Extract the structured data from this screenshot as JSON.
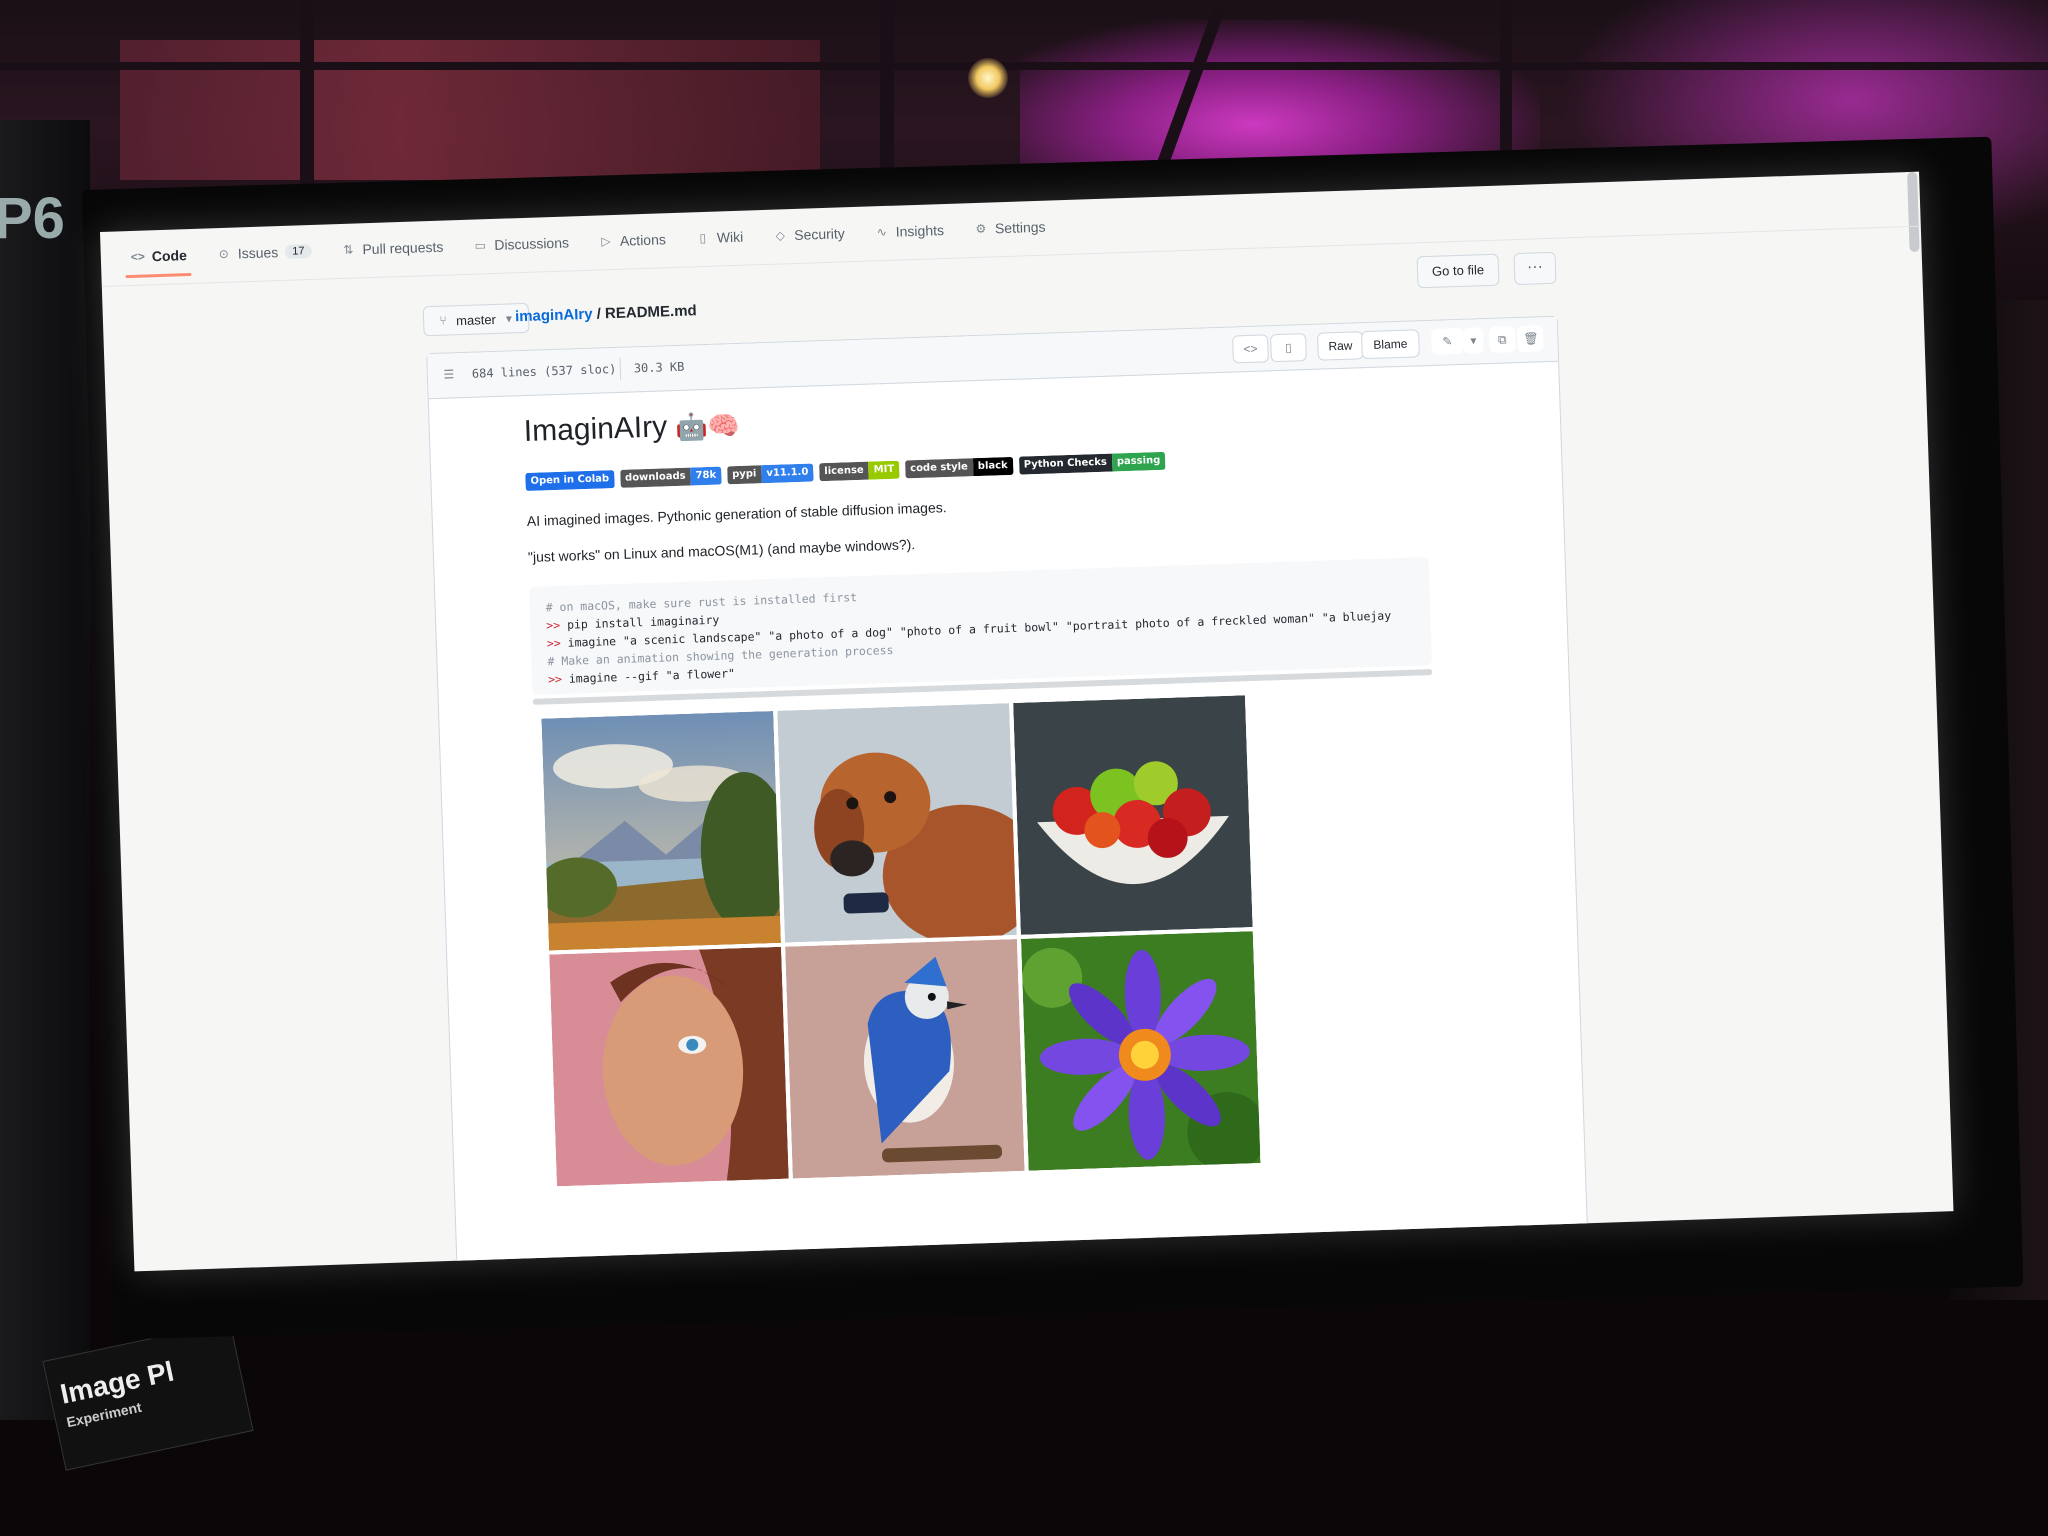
{
  "repo_nav": {
    "code": "Code",
    "issues": "Issues",
    "issues_count": "17",
    "pull_requests": "Pull requests",
    "discussions": "Discussions",
    "actions": "Actions",
    "wiki": "Wiki",
    "security": "Security",
    "insights": "Insights",
    "settings": "Settings"
  },
  "breadcrumb": {
    "branch": "master",
    "repo": "imaginAIry",
    "separator": "/",
    "file": "README.md"
  },
  "header_buttons": {
    "go_to_file": "Go to file",
    "more": "···"
  },
  "file_header": {
    "lines": "684 lines (537 sloc)",
    "size": "30.3 KB",
    "raw": "Raw",
    "blame": "Blame"
  },
  "readme": {
    "title": "ImaginAIry",
    "title_emoji": "🤖🧠",
    "badges": [
      {
        "left": "Open in Colab",
        "right": "",
        "left_color": "#1f6feb",
        "right_color": "#1f6feb"
      },
      {
        "left": "downloads",
        "right": "78k",
        "left_color": "#555555",
        "right_color": "#2f80ed"
      },
      {
        "left": "pypi",
        "right": "v11.1.0",
        "left_color": "#555555",
        "right_color": "#2f80ed"
      },
      {
        "left": "license",
        "right": "MIT",
        "left_color": "#555555",
        "right_color": "#97ca00"
      },
      {
        "left": "code style",
        "right": "black",
        "left_color": "#555555",
        "right_color": "#000000"
      },
      {
        "left": "Python Checks",
        "right": "passing",
        "left_color": "#24292f",
        "right_color": "#2ea44f"
      }
    ],
    "description": "AI imagined images. Pythonic generation of stable diffusion images.",
    "platforms": "\"just works\" on Linux and macOS(M1) (and maybe windows?).",
    "code_lines": [
      {
        "kind": "comment",
        "text": "# on macOS, make sure rust is installed first"
      },
      {
        "kind": "prompt",
        "prompt": ">>",
        "text": " pip install imaginairy"
      },
      {
        "kind": "prompt",
        "prompt": ">>",
        "text": " imagine \"a scenic landscape\" \"a photo of a dog\" \"photo of a fruit bowl\" \"portrait photo of a freckled woman\" \"a bluejay"
      },
      {
        "kind": "comment",
        "text": "# Make an animation showing the generation process"
      },
      {
        "kind": "prompt",
        "prompt": ">>",
        "text": " imagine --gif \"a flower\""
      }
    ]
  },
  "image_grid": [
    "scenic-landscape",
    "dog",
    "fruit-bowl",
    "freckled-woman",
    "bluejay",
    "flower"
  ],
  "environment": {
    "sign_title": "Image Pl",
    "sign_sub": "Experiment"
  },
  "colors": {
    "link": "#0969da",
    "selected_tab_underline": "#fd8c73",
    "stage_light": "#d53bc8"
  }
}
